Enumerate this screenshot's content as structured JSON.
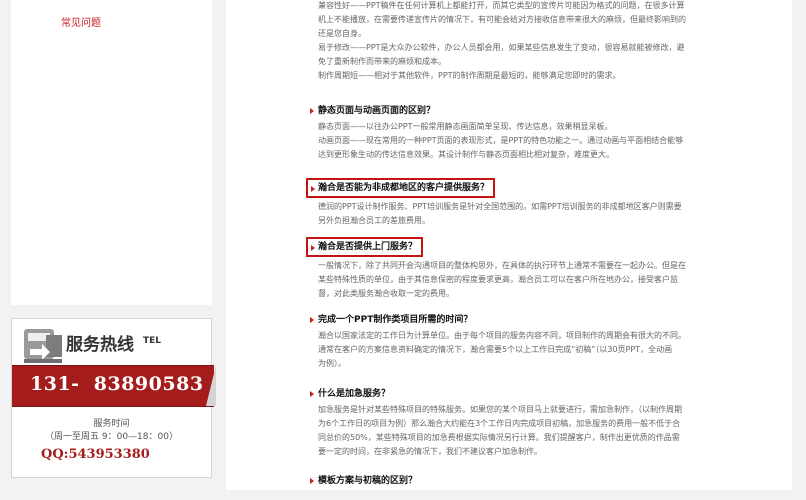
{
  "sidebar": {
    "faq_link": "常见问题",
    "hotline": {
      "title": "服务热线",
      "tel_tag": "TEL",
      "phone": "131-  83890583",
      "service_time_label": "服务时间",
      "service_hours": "（周一至周五  9：00—18：00）",
      "qq": "QQ:543953380"
    }
  },
  "content": {
    "intro_lines": [
      "兼容性好——PPT稿件在任何计算机上都能打开，而其它类型的宣传片可能因为格式的问题，在很多计算",
      "机上不能播放，在需要传递宣传片的情况下，有可能会给对方接收信息带来很大的麻烦，但最终影响到的",
      "还是您自身。",
      "易于修改——PPT是大众办公软件，办公人员都会用，如果某些信息发生了变动，很容易就能被修改，避",
      "免了重新制作而带来的麻烦和成本。",
      "制作周期短——相对于其他软件，PPT的制作周期是最短的，能够满足您即时的需求。"
    ],
    "faqs": [
      {
        "question": "静态页面与动画页面的区别？",
        "highlighted": false,
        "answer": [
          "静态页面——以往办公PPT一般常用静态画面简单呈现、传达信息，效果稍显呆板。",
          "动画页面——现在常用的一种PPT页面的表现形式，是PPT的特色功能之一。通过动画与平面相结合能够",
          "达到更形象生动的传达信息效果。其设计制作与静态页面相比相对复杂，难度更大。"
        ]
      },
      {
        "question": "瀚合是否能为非成都地区的客户提供服务？",
        "highlighted": true,
        "answer": [
          "德润的PPT设计制作服务、PPT培训服务是针对全国范围的。如需PPT培训服务的非成都地区客户则需要",
          "另外负担瀚合员工的差旅费用。"
        ]
      },
      {
        "question": "瀚合是否提供上门服务？",
        "highlighted": true,
        "answer": [
          "一般情况下，除了共同开会沟通项目的整体构思外，在具体的执行环节上通常不需要在一起办公。但是在",
          "某些特殊性质的单位，由于其信息保密的程度要求更高，瀚合员工可以在客户所在地办公，接受客户监",
          "督，对此类服务瀚合收取一定的费用。"
        ]
      },
      {
        "question": "完成一个PPT制作类项目所需的时间？",
        "highlighted": false,
        "answer": [
          "瀚合以国家法定的工作日为计算单位。由于每个项目的服务内容不同，项目制作的周期会有很大的不同。",
          "通常在客户的方案信息资料确定的情况下，瀚合需要5个以上工作日完成“初稿”（以30页PPT，全动画",
          "为例）。"
        ]
      },
      {
        "question": "什么是加急服务？",
        "highlighted": false,
        "answer": [
          "加急服务是针对某些特殊项目的特殊服务。如果您的某个项目马上就要进行，需加急制作，（以制作周期",
          "为6个工作日的项目为例）那么瀚合大约能在3个工作日内完成项目初稿，加急服务的费用一般不低于合",
          "同总价的50%，某些特殊项目的加急费根据实际情况另行计算。我们提醒客户，制作出更优质的作品需",
          "要一定的时间，在非紧急的情况下，我们不建议客户加急制作。"
        ]
      },
      {
        "question": "模板方案与初稿的区别？",
        "highlighted": false,
        "answer": []
      }
    ]
  }
}
